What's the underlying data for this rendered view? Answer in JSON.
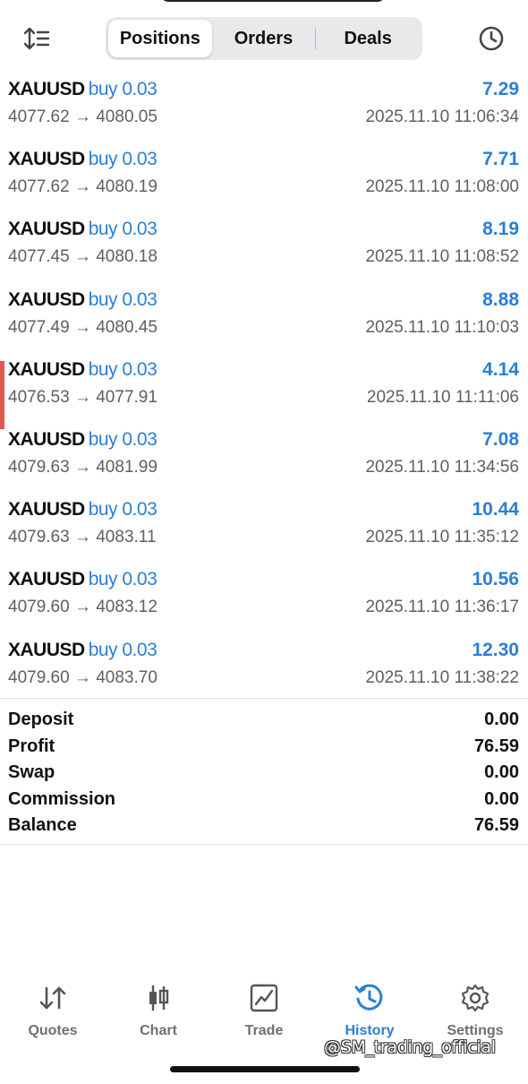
{
  "header": {
    "tabs": [
      {
        "label": "Positions",
        "active": true
      },
      {
        "label": "Orders",
        "active": false
      },
      {
        "label": "Deals",
        "active": false
      }
    ],
    "left_icon": "sort-icon",
    "right_icon": "clock-icon"
  },
  "deals": [
    {
      "symbol": "XAUUSD",
      "side": "buy 0.03",
      "profit": "7.29",
      "prices": "4077.62 → 4080.05",
      "time": "2025.11.10 11:06:34",
      "marked": false
    },
    {
      "symbol": "XAUUSD",
      "side": "buy 0.03",
      "profit": "7.71",
      "prices": "4077.62 → 4080.19",
      "time": "2025.11.10 11:08:00",
      "marked": false
    },
    {
      "symbol": "XAUUSD",
      "side": "buy 0.03",
      "profit": "8.19",
      "prices": "4077.45 → 4080.18",
      "time": "2025.11.10 11:08:52",
      "marked": false
    },
    {
      "symbol": "XAUUSD",
      "side": "buy 0.03",
      "profit": "8.88",
      "prices": "4077.49 → 4080.45",
      "time": "2025.11.10 11:10:03",
      "marked": false
    },
    {
      "symbol": "XAUUSD",
      "side": "buy 0.03",
      "profit": "4.14",
      "prices": "4076.53 → 4077.91",
      "time": "2025.11.10 11:11:06",
      "marked": true
    },
    {
      "symbol": "XAUUSD",
      "side": "buy 0.03",
      "profit": "7.08",
      "prices": "4079.63 → 4081.99",
      "time": "2025.11.10 11:34:56",
      "marked": false
    },
    {
      "symbol": "XAUUSD",
      "side": "buy 0.03",
      "profit": "10.44",
      "prices": "4079.63 → 4083.11",
      "time": "2025.11.10 11:35:12",
      "marked": false
    },
    {
      "symbol": "XAUUSD",
      "side": "buy 0.03",
      "profit": "10.56",
      "prices": "4079.60 → 4083.12",
      "time": "2025.11.10 11:36:17",
      "marked": false
    },
    {
      "symbol": "XAUUSD",
      "side": "buy 0.03",
      "profit": "12.30",
      "prices": "4079.60 → 4083.70",
      "time": "2025.11.10 11:38:22",
      "marked": false
    }
  ],
  "summary": [
    {
      "label": "Deposit",
      "value": "0.00"
    },
    {
      "label": "Profit",
      "value": "76.59"
    },
    {
      "label": "Swap",
      "value": "0.00"
    },
    {
      "label": "Commission",
      "value": "0.00"
    },
    {
      "label": "Balance",
      "value": "76.59"
    }
  ],
  "tabbar": [
    {
      "label": "Quotes",
      "icon": "quotes-icon",
      "active": false
    },
    {
      "label": "Chart",
      "icon": "candlestick-chart-icon",
      "active": false
    },
    {
      "label": "Trade",
      "icon": "trade-chart-icon",
      "active": false
    },
    {
      "label": "History",
      "icon": "history-icon",
      "active": true
    },
    {
      "label": "Settings",
      "icon": "gear-icon",
      "active": false
    }
  ],
  "watermark": "@SM_trading_official",
  "colors": {
    "accent": "#2a7fd4",
    "marker": "#e0594f",
    "secondary_text": "#5f5f5f"
  }
}
